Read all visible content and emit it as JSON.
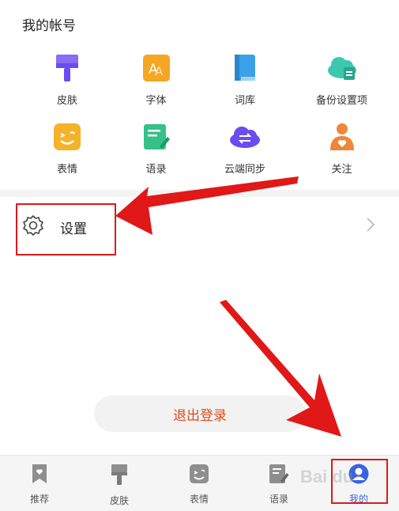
{
  "account": {
    "title": "我的帐号"
  },
  "grid": {
    "items": [
      {
        "label": "皮肤",
        "icon": "paint-brush-icon",
        "color": "#6a4cf0"
      },
      {
        "label": "字体",
        "icon": "font-icon",
        "color": "#f5a623"
      },
      {
        "label": "词库",
        "icon": "book-icon",
        "color": "#3aa0e8"
      },
      {
        "label": "备份设置项",
        "icon": "cloud-backup-icon",
        "color": "#3bc8b0"
      },
      {
        "label": "表情",
        "icon": "emoji-icon",
        "color": "#f5b32a"
      },
      {
        "label": "语录",
        "icon": "note-edit-icon",
        "color": "#36c18a"
      },
      {
        "label": "云端同步",
        "icon": "cloud-sync-icon",
        "color": "#6a4cf0"
      },
      {
        "label": "关注",
        "icon": "follow-person-icon",
        "color": "#f0863a"
      }
    ]
  },
  "settings": {
    "label": "设置"
  },
  "logout": {
    "label": "退出登录"
  },
  "tabbar": {
    "tabs": [
      {
        "label": "推荐",
        "icon": "bookmark-heart-icon"
      },
      {
        "label": "皮肤",
        "icon": "paint-brush-icon"
      },
      {
        "label": "表情",
        "icon": "emoji-icon"
      },
      {
        "label": "语录",
        "icon": "note-edit-icon"
      },
      {
        "label": "我的",
        "icon": "user-avatar-icon",
        "active": true
      }
    ],
    "active_color": "#3a63e0"
  },
  "annotation_color": "#e01818"
}
